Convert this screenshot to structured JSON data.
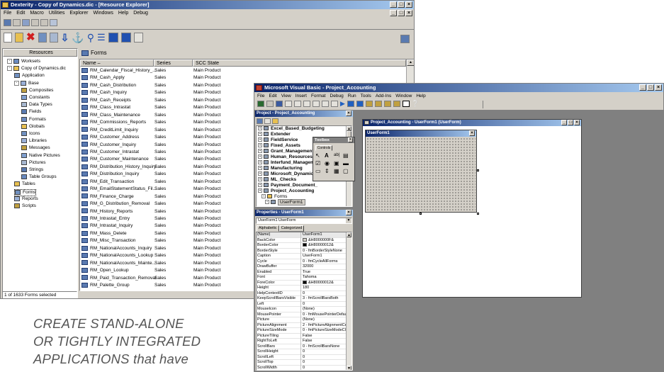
{
  "main_window": {
    "title": "Dexterity - Copy of Dynamics.dic - [Resource Explorer]",
    "menu": [
      "File",
      "Edit",
      "Macro",
      "Utilities",
      "Explorer",
      "Windows",
      "Help",
      "Debug"
    ],
    "resources_header": "Resources",
    "forms_header": "Forms",
    "status": "1 of 1633 Forms selected",
    "tree": [
      {
        "label": "Worksets",
        "depth": 0
      },
      {
        "label": "Copy of Dynamics.dic",
        "depth": 0
      },
      {
        "label": "Application",
        "depth": 1
      },
      {
        "label": "Base",
        "depth": 1
      },
      {
        "label": "Composites",
        "depth": 2
      },
      {
        "label": "Constants",
        "depth": 2
      },
      {
        "label": "Data Types",
        "depth": 2
      },
      {
        "label": "Fields",
        "depth": 2
      },
      {
        "label": "Formats",
        "depth": 2
      },
      {
        "label": "Globals",
        "depth": 2
      },
      {
        "label": "Icons",
        "depth": 2
      },
      {
        "label": "Libraries",
        "depth": 2
      },
      {
        "label": "Messages",
        "depth": 2
      },
      {
        "label": "Native Pictures",
        "depth": 2
      },
      {
        "label": "Pictures",
        "depth": 2
      },
      {
        "label": "Strings",
        "depth": 2
      },
      {
        "label": "Table Groups",
        "depth": 2
      },
      {
        "label": "Tables",
        "depth": 1
      },
      {
        "label": "Forms",
        "depth": 1
      },
      {
        "label": "Reports",
        "depth": 1
      },
      {
        "label": "Scripts",
        "depth": 1
      }
    ],
    "columns": [
      "Name",
      "Series",
      "SCC State"
    ],
    "forms": [
      [
        "RM_Calendar_Fiscal_History_...",
        "Sales",
        "Main Product"
      ],
      [
        "RM_Cash_Apply",
        "Sales",
        "Main Product"
      ],
      [
        "RM_Cash_Distribution",
        "Sales",
        "Main Product"
      ],
      [
        "RM_Cash_Inquiry",
        "Sales",
        "Main Product"
      ],
      [
        "RM_Cash_Receipts",
        "Sales",
        "Main Product"
      ],
      [
        "RM_Class_Intrastat",
        "Sales",
        "Main Product"
      ],
      [
        "RM_Class_Maintenance",
        "Sales",
        "Main Product"
      ],
      [
        "RM_Commissions_Reports",
        "Sales",
        "Main Product"
      ],
      [
        "RM_CreditLimit_Inquiry",
        "Sales",
        "Main Product"
      ],
      [
        "RM_Customer_Address",
        "Sales",
        "Main Product"
      ],
      [
        "RM_Customer_Inquiry",
        "Sales",
        "Main Product"
      ],
      [
        "RM_Customer_Intrastat",
        "Sales",
        "Main Product"
      ],
      [
        "RM_Customer_Maintenance",
        "Sales",
        "Main Product"
      ],
      [
        "RM_Distribution_History_Inquiry",
        "Sales",
        "Main Product"
      ],
      [
        "RM_Distribution_Inquiry",
        "Sales",
        "Main Product"
      ],
      [
        "RM_Edit_Transaction",
        "Sales",
        "Main Product"
      ],
      [
        "RM_EmailStatementStatus_Fil...",
        "Sales",
        "Main Product"
      ],
      [
        "RM_Finance_Charge",
        "Sales",
        "Main Product"
      ],
      [
        "RM_G_Distribution_Removal",
        "Sales",
        "Main Product"
      ],
      [
        "RM_History_Reports",
        "Sales",
        "Main Product"
      ],
      [
        "RM_Intrastat_Entry",
        "Sales",
        "Main Product"
      ],
      [
        "RM_Intrastat_Inquiry",
        "Sales",
        "Main Product"
      ],
      [
        "RM_Mass_Delete",
        "Sales",
        "Main Product"
      ],
      [
        "RM_Misc_Transaction",
        "Sales",
        "Main Product"
      ],
      [
        "RM_NationalAccounts_Inquiry",
        "Sales",
        "Main Product"
      ],
      [
        "RM_NationalAccounts_Lookup",
        "Sales",
        "Main Product"
      ],
      [
        "RM_NationalAccounts_Mainte...",
        "Sales",
        "Main Product"
      ],
      [
        "RM_Open_Lookup",
        "Sales",
        "Main Product"
      ],
      [
        "RM_Paid_Transaction_Removal",
        "Sales",
        "Main Product"
      ],
      [
        "RM_Palette_Group",
        "Sales",
        "Main Product"
      ]
    ]
  },
  "vb_window": {
    "title": "Microsoft Visual Basic - Project_Accounting",
    "menu": [
      "File",
      "Edit",
      "View",
      "Insert",
      "Format",
      "Debug",
      "Run",
      "Tools",
      "Add-Ins",
      "Window",
      "Help"
    ],
    "project_title": "Project - Project_Accounting",
    "project_items": [
      {
        "label": "Excel_Based_Budgeting",
        "bold": true,
        "depth": 1
      },
      {
        "label": "Extender",
        "bold": true,
        "depth": 1
      },
      {
        "label": "FieldService",
        "bold": true,
        "depth": 1
      },
      {
        "label": "Fixed_Assets",
        "bold": true,
        "depth": 1
      },
      {
        "label": "Grant_Management",
        "bold": true,
        "depth": 1
      },
      {
        "label": "Human_Resources",
        "bold": true,
        "depth": 1
      },
      {
        "label": "Interfund_Manageme",
        "bold": true,
        "depth": 1
      },
      {
        "label": "Manufacturing",
        "bold": true,
        "depth": 1
      },
      {
        "label": "Microsoft_Dynamics_",
        "bold": true,
        "depth": 1
      },
      {
        "label": "ML_Checks",
        "bold": true,
        "depth": 1
      },
      {
        "label": "Payment_Document_",
        "bold": true,
        "depth": 1
      },
      {
        "label": "Project_Accounting",
        "bold": true,
        "depth": 1
      },
      {
        "label": "Forms",
        "bold": false,
        "depth": 2
      },
      {
        "label": "UserForm1",
        "bold": false,
        "depth": 3
      }
    ],
    "toolbox_title": "Toolbox",
    "toolbox_tab": "Controls",
    "properties_title": "Properties - UserForm1",
    "properties_object": "UserForm1 UserForm",
    "properties_tabs": [
      "Alphabetic",
      "Categorized"
    ],
    "properties": [
      [
        "(Name)",
        "UserForm1"
      ],
      [
        "BackColor",
        "&H8000000F&"
      ],
      [
        "BorderColor",
        "&H80000012&"
      ],
      [
        "BorderStyle",
        "0 - fmBorderStyleNone"
      ],
      [
        "Caption",
        "UserForm1"
      ],
      [
        "Cycle",
        "0 - fmCycleAllForms"
      ],
      [
        "DrawBuffer",
        "32000"
      ],
      [
        "Enabled",
        "True"
      ],
      [
        "Font",
        "Tahoma"
      ],
      [
        "ForeColor",
        "&H80000012&"
      ],
      [
        "Height",
        "180"
      ],
      [
        "HelpContextID",
        "0"
      ],
      [
        "KeepScrollBarsVisible",
        "3 - fmScrollBarsBoth"
      ],
      [
        "Left",
        "0"
      ],
      [
        "MouseIcon",
        "(None)"
      ],
      [
        "MousePointer",
        "0 - fmMousePointerDefault"
      ],
      [
        "Picture",
        "(None)"
      ],
      [
        "PictureAlignment",
        "2 - fmPictureAlignmentCenter"
      ],
      [
        "PictureSizeMode",
        "0 - fmPictureSizeModeClip"
      ],
      [
        "PictureTiling",
        "False"
      ],
      [
        "RightToLeft",
        "False"
      ],
      [
        "ScrollBars",
        "0 - fmScrollBarsNone"
      ],
      [
        "ScrollHeight",
        "0"
      ],
      [
        "ScrollLeft",
        "0"
      ],
      [
        "ScrollTop",
        "0"
      ],
      [
        "ScrollWidth",
        "0"
      ]
    ],
    "designer_title": "Project_Accounting - UserForm1 (UserForm)",
    "form_caption": "UserForm1"
  },
  "tagline": [
    "CREATE STAND-ALONE",
    "OR TIGHTLY INTEGRATED",
    "APPLICATIONS that have"
  ]
}
